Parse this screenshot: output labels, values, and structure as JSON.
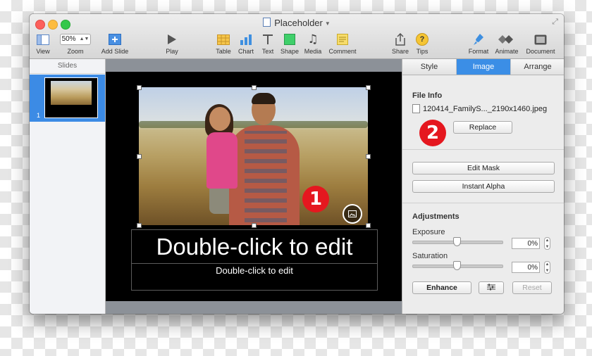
{
  "window": {
    "title": "Placeholder"
  },
  "toolbar": {
    "items": [
      {
        "label": "View"
      },
      {
        "label": "Zoom",
        "value": "50%"
      },
      {
        "label": "Add Slide"
      },
      {
        "label": "Play"
      },
      {
        "label": "Table"
      },
      {
        "label": "Chart"
      },
      {
        "label": "Text"
      },
      {
        "label": "Shape"
      },
      {
        "label": "Media"
      },
      {
        "label": "Comment"
      },
      {
        "label": "Share"
      },
      {
        "label": "Tips"
      },
      {
        "label": "Format"
      },
      {
        "label": "Animate"
      },
      {
        "label": "Document"
      }
    ]
  },
  "slides_panel": {
    "header": "Slides",
    "slides": [
      {
        "number": "1"
      }
    ]
  },
  "slide": {
    "title_placeholder": "Double-click to edit",
    "subtitle_placeholder": "Double-click to edit",
    "marker_1": "1"
  },
  "inspector": {
    "tabs": [
      {
        "label": "Style"
      },
      {
        "label": "Image",
        "active": true
      },
      {
        "label": "Arrange"
      }
    ],
    "file_info": {
      "title": "File Info",
      "filename": "120414_FamilyS..._2190x1460.jpeg",
      "replace_label": "Replace",
      "marker_2": "2"
    },
    "edit_mask_label": "Edit Mask",
    "instant_alpha_label": "Instant Alpha",
    "adjustments": {
      "title": "Adjustments",
      "exposure_label": "Exposure",
      "exposure_value": "0%",
      "saturation_label": "Saturation",
      "saturation_value": "0%",
      "enhance_label": "Enhance",
      "reset_label": "Reset"
    }
  },
  "colors": {
    "accent": "#3b8ee6",
    "marker_red": "#e5171f",
    "slide_background": "#000000",
    "canvas_gray": "#8c9198"
  },
  "icons": {
    "view": "view-icon",
    "zoom": "zoom-dropdown",
    "add_slide": "add-slide-icon",
    "play": "play-icon",
    "table": "table-icon",
    "chart": "chart-icon",
    "text": "text-icon",
    "shape": "shape-icon",
    "media": "media-icon",
    "comment": "comment-icon",
    "share": "share-icon",
    "tips": "tips-icon",
    "format": "format-icon",
    "animate": "animate-icon",
    "document": "document-icon"
  }
}
